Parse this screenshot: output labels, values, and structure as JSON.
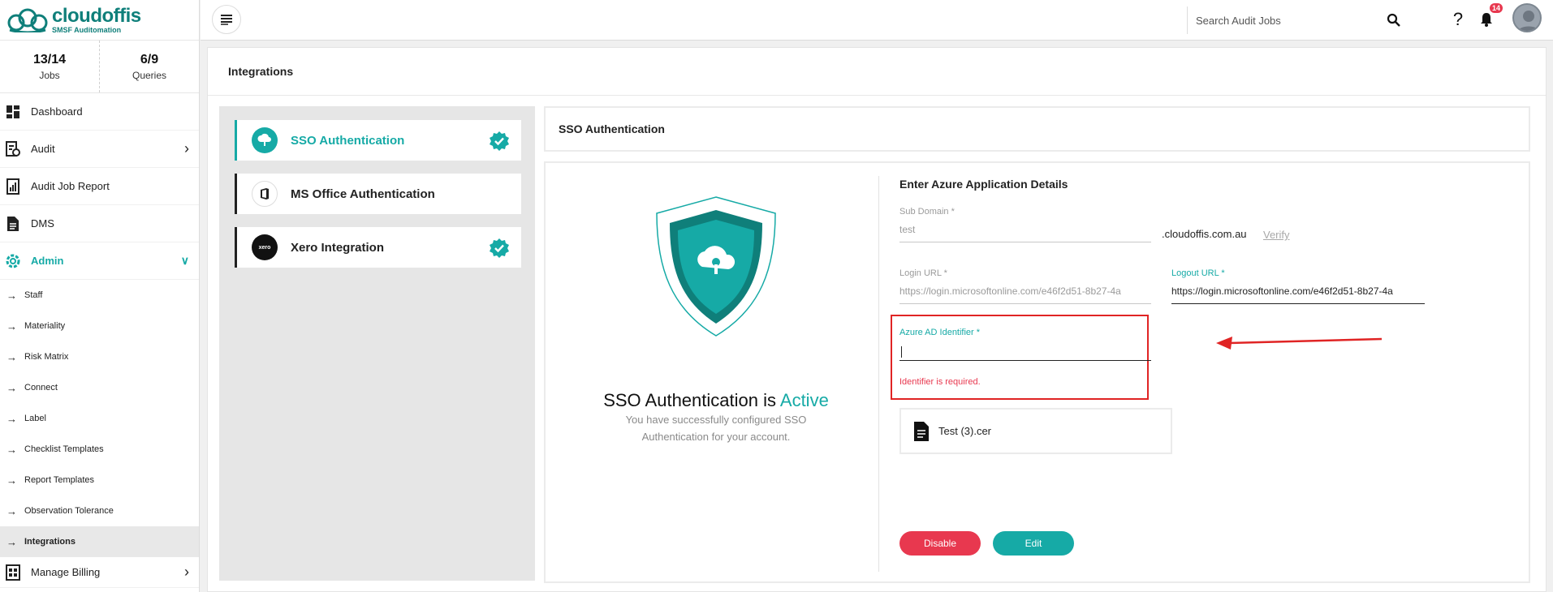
{
  "brand": {
    "name": "cloudoffis",
    "tagline": "SMSF Auditomation",
    "color": "#0f7f7a"
  },
  "stats": [
    {
      "value": "13/14",
      "label": "Jobs"
    },
    {
      "value": "6/9",
      "label": "Queries"
    }
  ],
  "nav": {
    "dashboard": "Dashboard",
    "audit": "Audit",
    "audit_job_report": "Audit Job Report",
    "dms": "DMS",
    "admin": "Admin",
    "admin_items": [
      "Staff",
      "Materiality",
      "Risk Matrix",
      "Connect",
      "Label",
      "Checklist Templates",
      "Report Templates",
      "Observation Tolerance",
      "Integrations"
    ],
    "manage_billing": "Manage Billing"
  },
  "topbar": {
    "search_placeholder": "Search Audit Jobs",
    "notification_count": "14"
  },
  "page": {
    "title": "Integrations"
  },
  "integrations": [
    {
      "label": "SSO Authentication",
      "active": true,
      "verified": true
    },
    {
      "label": "MS Office Authentication",
      "active": false,
      "verified": false
    },
    {
      "label": "Xero Integration",
      "active": false,
      "verified": true
    }
  ],
  "panel": {
    "header": "SSO Authentication",
    "status_prefix": "SSO Authentication is",
    "status_word": "Active",
    "status_desc": "You have successfully configured SSO Authentication for your account.",
    "form_title": "Enter Azure Application Details",
    "sub_domain": {
      "label": "Sub Domain *",
      "value": "test",
      "suffix": ".cloudoffis.com.au",
      "verify": "Verify"
    },
    "login_url": {
      "label": "Login URL *",
      "value": "https://login.microsoftonline.com/e46f2d51-8b27-4a"
    },
    "logout_url": {
      "label": "Logout URL *",
      "value": "https://login.microsoftonline.com/e46f2d51-8b27-4a"
    },
    "azure_ad": {
      "label": "Azure AD Identifier *",
      "value": "",
      "error": "Identifier is required."
    },
    "file": {
      "name": "Test (3).cer"
    },
    "buttons": {
      "disable": "Disable",
      "edit": "Edit"
    }
  },
  "colors": {
    "accent": "#16aaa6",
    "danger": "#e8384f",
    "highlight_box": "#e02424"
  }
}
